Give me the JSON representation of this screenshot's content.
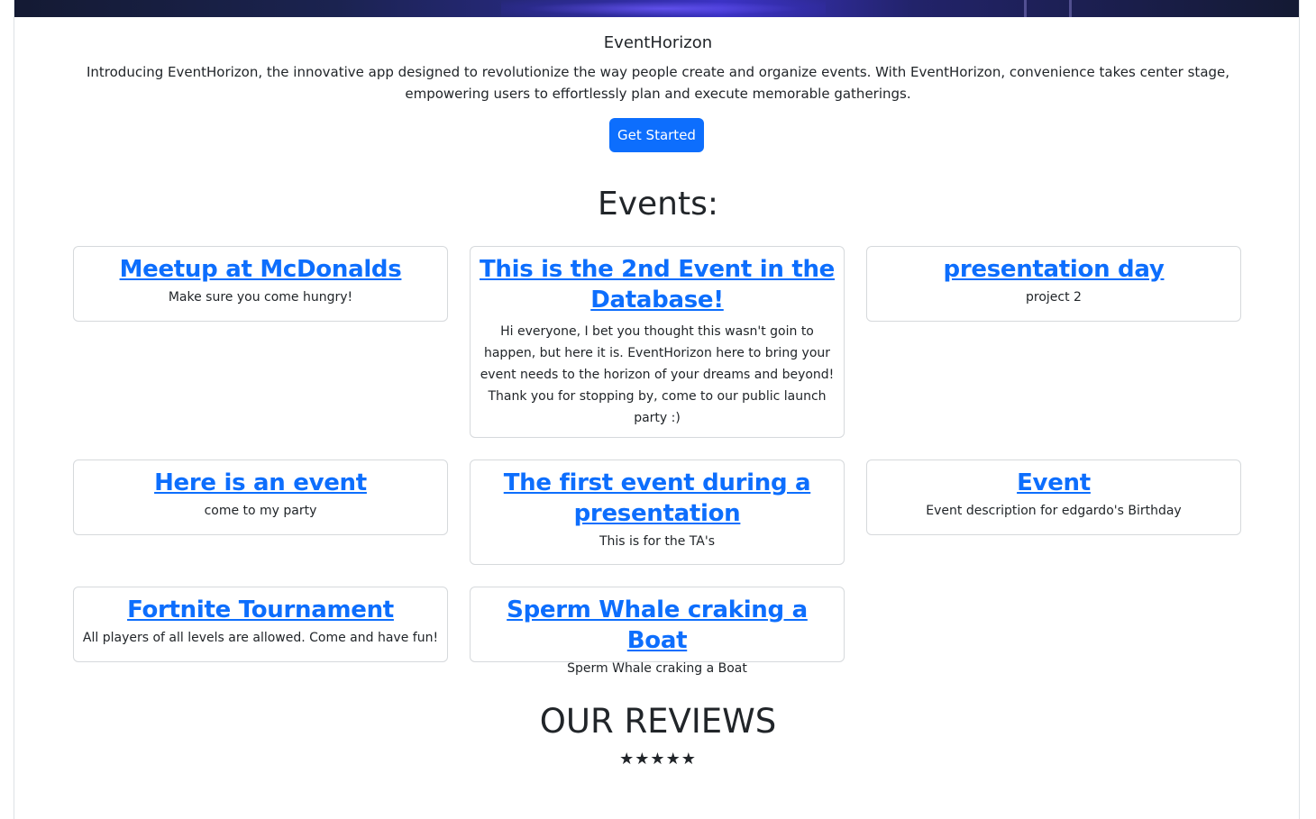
{
  "brand": {
    "name": "EventHorizon"
  },
  "hero": {
    "intro": "Introducing EventHorizon, the innovative app designed to revolutionize the way people create and organize events. With EventHorizon, convenience takes center stage, empowering users to effortlessly plan and execute memorable gatherings.",
    "cta_label": "Get Started"
  },
  "events": {
    "heading": "Events:",
    "items": [
      {
        "title": "Meetup at McDonalds",
        "description": "Make sure you come hungry!"
      },
      {
        "title": "This is the 2nd Event in the Database!",
        "description": "Hi everyone, I bet you thought this wasn't goin to happen, but here it is. EventHorizon here to bring your event needs to the horizon of your dreams and beyond! Thank you for stopping by, come to our public launch party :)"
      },
      {
        "title": "presentation day",
        "description": "project 2"
      },
      {
        "title": "Here is an event",
        "description": "come to my party"
      },
      {
        "title": "The first event during a presentation",
        "description": "This is for the TA's"
      },
      {
        "title": "Event",
        "description": "Event description for edgardo's Birthday"
      },
      {
        "title": "Fortnite Tournament",
        "description": "All players of all levels are allowed. Come and have fun!"
      },
      {
        "title": "Sperm Whale craking a Boat",
        "description": "Sperm Whale craking a Boat"
      }
    ]
  },
  "reviews": {
    "heading": "OUR REVIEWS",
    "stars": "★★★★★",
    "rating": 5
  },
  "colors": {
    "link": "#0d6efd",
    "button": "#0d6efd",
    "text": "#212529",
    "card_border": "#d6d9dc"
  }
}
